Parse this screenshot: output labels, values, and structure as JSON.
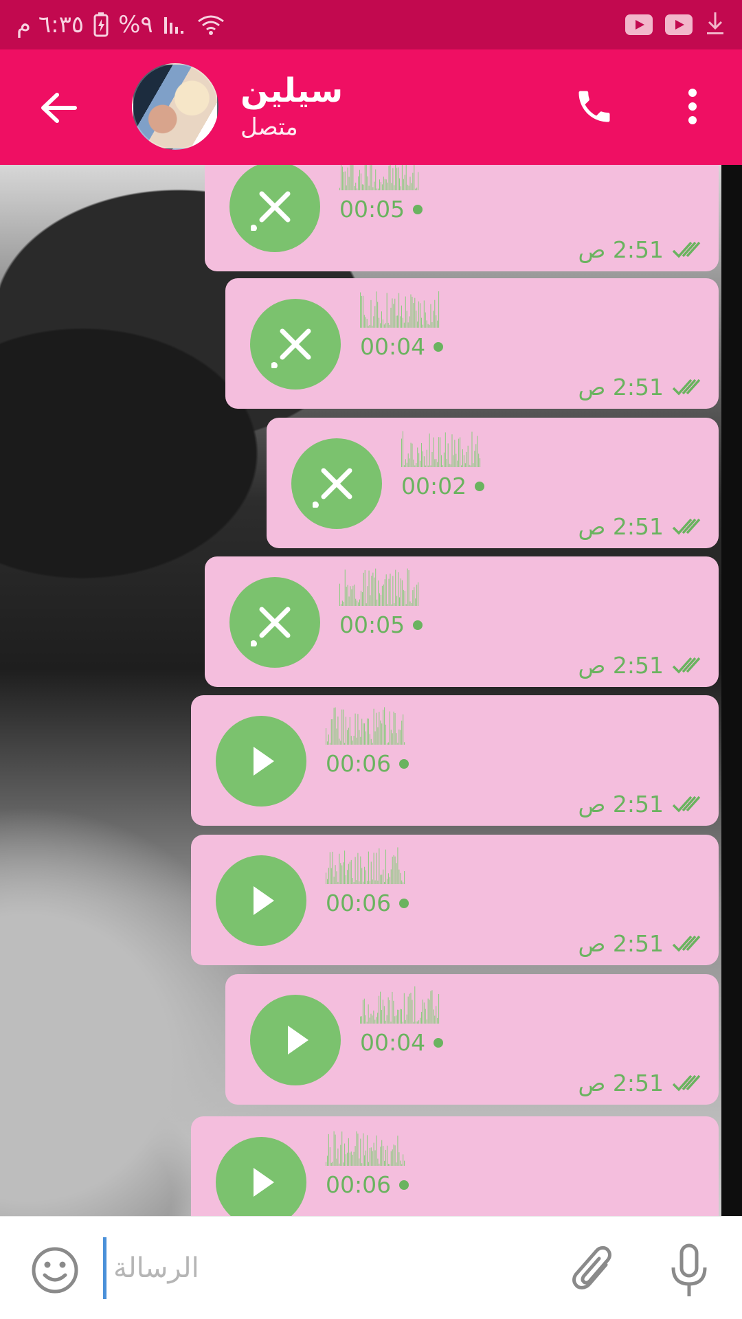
{
  "status_bar": {
    "time": "٦:٣٥ م",
    "battery": "%٩",
    "colors": {
      "background": "#c2094f",
      "foreground": "#f7d2e0"
    }
  },
  "header": {
    "contact_name": "سيلين",
    "contact_status": "متصل",
    "colors": {
      "background": "#ef0f63"
    }
  },
  "messages": [
    {
      "state": "cancel",
      "duration": "00:05",
      "time": "2:51 ص",
      "checks": "double"
    },
    {
      "state": "cancel",
      "duration": "00:04",
      "time": "2:51 ص",
      "checks": "double"
    },
    {
      "state": "cancel",
      "duration": "00:02",
      "time": "2:51 ص",
      "checks": "double"
    },
    {
      "state": "cancel",
      "duration": "00:05",
      "time": "2:51 ص",
      "checks": "double"
    },
    {
      "state": "play",
      "duration": "00:06",
      "time": "2:51 ص",
      "checks": "double"
    },
    {
      "state": "play",
      "duration": "00:06",
      "time": "2:51 ص",
      "checks": "double"
    },
    {
      "state": "play",
      "duration": "00:04",
      "time": "2:51 ص",
      "checks": "double"
    },
    {
      "state": "play",
      "duration": "00:06",
      "time": "",
      "checks": "double"
    }
  ],
  "input": {
    "placeholder": "الرسالة",
    "value": ""
  },
  "icons": {
    "back": "arrow-left-icon",
    "call": "phone-icon",
    "menu": "more-vert-icon",
    "emoji": "smiley-icon",
    "attach": "paperclip-icon",
    "mic": "microphone-icon",
    "cancel": "close-icon",
    "play": "play-icon",
    "read": "double-check-icon"
  },
  "colors": {
    "bubble": "#f4bedd",
    "accent_green": "#7bc26e",
    "text_green": "#6ab35f"
  }
}
